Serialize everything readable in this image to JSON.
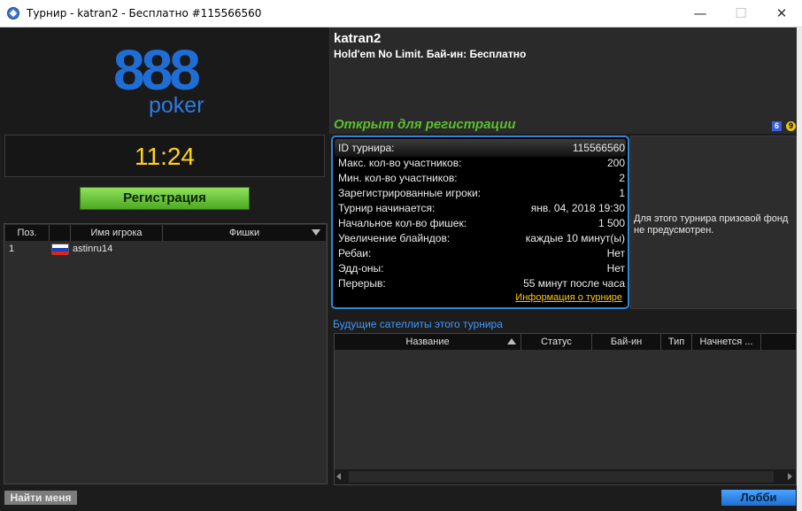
{
  "window": {
    "title": "Турнир - katran2 - Бесплатно #115566560",
    "minimize": "—",
    "maximize": "☐",
    "close": "✕"
  },
  "logo": {
    "top": "888",
    "bottom": "poker",
    "colors": {
      "brand": "#1f6ed6"
    }
  },
  "clock": "11:24",
  "register_label": "Регистрация",
  "players": {
    "columns": {
      "pos": "Поз.",
      "name": "Имя игрока",
      "chips": "Фишки"
    },
    "rows": [
      {
        "pos": "1",
        "flag": "ru-flag-icon",
        "name": "astinru14"
      }
    ]
  },
  "find_me_label": "Найти меня",
  "tournament": {
    "name": "katran2",
    "type": "Hold'em No Limit. Бай-ин: Бесплатно",
    "status": "Открыт для регистрации",
    "badges": [
      "6",
      "9"
    ]
  },
  "details": [
    {
      "label": "ID турнира:",
      "value": "115566560"
    },
    {
      "label": "Макс. кол-во участников:",
      "value": "200"
    },
    {
      "label": "Мин. кол-во участников:",
      "value": "2"
    },
    {
      "label": "Зарегистрированные игроки:",
      "value": "1"
    },
    {
      "label": "Турнир начинается:",
      "value": "янв. 04, 2018 19:30"
    },
    {
      "label": "Начальное кол-во фишек:",
      "value": "1 500"
    },
    {
      "label": "Увеличение блайндов:",
      "value": "каждые 10 минут(ы)"
    },
    {
      "label": "Ребаи:",
      "value": "Нет"
    },
    {
      "label": "Эдд-оны:",
      "value": "Нет"
    },
    {
      "label": "Перерыв:",
      "value": "55 минут после часа"
    }
  ],
  "details_link": "Информация о турнире",
  "prize_text": "Для этого турнира призовой фонд не предусмотрен.",
  "satellites": {
    "title": "Будущие сателлиты этого турнира",
    "columns": {
      "name": "Название",
      "status": "Статус",
      "buyin": "Бай-ин",
      "type": "Тип",
      "start": "Начнется ..."
    }
  },
  "lobby_label": "Лобби"
}
